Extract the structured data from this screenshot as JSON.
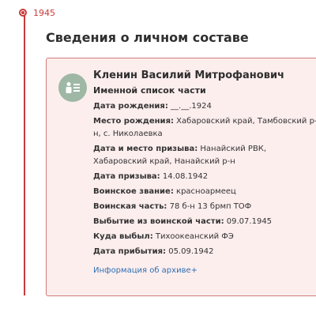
{
  "timeline": {
    "year": "1945"
  },
  "section": {
    "title": "Сведения о личном составе"
  },
  "card": {
    "name": "Кленин Василий Митрофанович",
    "doc_type": "Именной список части",
    "fields": [
      {
        "label": "Дата рождения:",
        "value": "__.__.1924"
      },
      {
        "label": "Место рождения:",
        "value": "Хабаровский край, Тамбовский р-н, с. Николаевка"
      },
      {
        "label": "Дата и место призыва:",
        "value": "Нанайский РВК, Хабаровский край, Нанайский р-н"
      },
      {
        "label": "Дата призыва:",
        "value": "14.08.1942"
      },
      {
        "label": "Воинское звание:",
        "value": "красноармеец"
      },
      {
        "label": "Воинская часть:",
        "value": "78 б-н 13 брмп ТОФ"
      },
      {
        "label": "Выбытие из воинской части:",
        "value": "09.07.1945"
      },
      {
        "label": "Куда выбыл:",
        "value": "Тихоокеанский ФЭ"
      },
      {
        "label": "Дата прибытия:",
        "value": "05.09.1942"
      }
    ],
    "archive_link": "Информация об архиве+"
  },
  "icons": {
    "avatar": "person-list-icon"
  },
  "colors": {
    "accent": "#c83a3a",
    "card_bg": "#fdeeee",
    "card_border": "#d07a7a",
    "link": "#2f6fb0",
    "avatar_bg": "#9eb8a5"
  }
}
